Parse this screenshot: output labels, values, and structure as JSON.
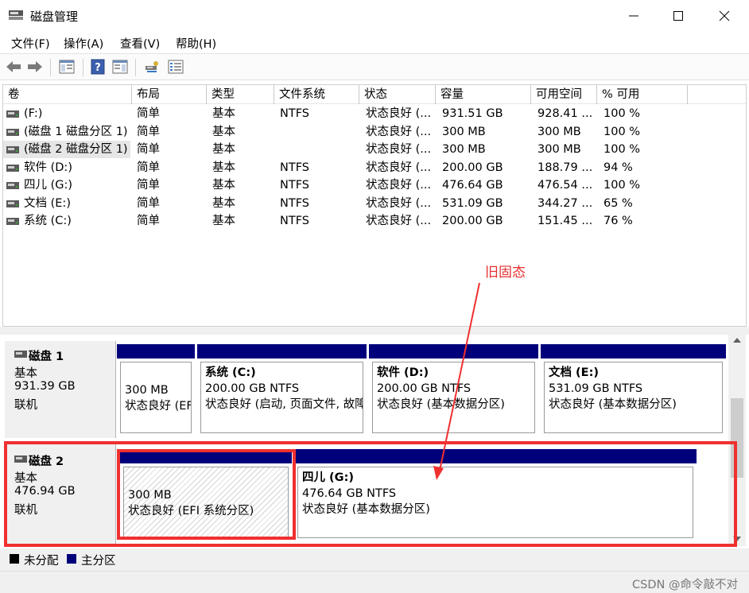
{
  "window": {
    "title": "磁盘管理"
  },
  "menu": [
    "文件(F)",
    "操作(A)",
    "查看(V)",
    "帮助(H)"
  ],
  "columns": [
    "卷",
    "布局",
    "类型",
    "文件系统",
    "状态",
    "容量",
    "可用空间",
    "% 可用"
  ],
  "volumes": [
    {
      "name": "(F:)",
      "layout": "简单",
      "type": "基本",
      "fs": "NTFS",
      "status": "状态良好 (...",
      "capacity": "931.51 GB",
      "free": "928.41 ...",
      "pct": "100 %"
    },
    {
      "name": "(磁盘 1 磁盘分区 1)",
      "layout": "简单",
      "type": "基本",
      "fs": "",
      "status": "状态良好 (...",
      "capacity": "300 MB",
      "free": "300 MB",
      "pct": "100 %"
    },
    {
      "name": "(磁盘 2 磁盘分区 1)",
      "layout": "简单",
      "type": "基本",
      "fs": "",
      "status": "状态良好 (...",
      "capacity": "300 MB",
      "free": "300 MB",
      "pct": "100 %"
    },
    {
      "name": "软件 (D:)",
      "layout": "简单",
      "type": "基本",
      "fs": "NTFS",
      "status": "状态良好 (...",
      "capacity": "200.00 GB",
      "free": "188.79 ...",
      "pct": "94 %"
    },
    {
      "name": "四儿 (G:)",
      "layout": "简单",
      "type": "基本",
      "fs": "NTFS",
      "status": "状态良好 (...",
      "capacity": "476.64 GB",
      "free": "476.54 ...",
      "pct": "100 %"
    },
    {
      "name": "文档 (E:)",
      "layout": "简单",
      "type": "基本",
      "fs": "NTFS",
      "status": "状态良好 (...",
      "capacity": "531.09 GB",
      "free": "344.27 ...",
      "pct": "65 %"
    },
    {
      "name": "系统 (C:)",
      "layout": "简单",
      "type": "基本",
      "fs": "NTFS",
      "status": "状态良好 (...",
      "capacity": "200.00 GB",
      "free": "151.45 ...",
      "pct": "76 %"
    }
  ],
  "disks": [
    {
      "name": "磁盘 1",
      "type": "基本",
      "size": "931.39 GB",
      "state": "联机",
      "partitions": [
        {
          "name": "",
          "size": "300 MB",
          "status": "状态良好 (EFI"
        },
        {
          "name": "系统 (C:)",
          "size": "200.00 GB NTFS",
          "status": "状态良好 (启动, 页面文件, 故障"
        },
        {
          "name": "软件 (D:)",
          "size": "200.00 GB NTFS",
          "status": "状态良好 (基本数据分区)"
        },
        {
          "name": "文档 (E:)",
          "size": "531.09 GB NTFS",
          "status": "状态良好 (基本数据分区)"
        }
      ]
    },
    {
      "name": "磁盘 2",
      "type": "基本",
      "size": "476.94 GB",
      "state": "联机",
      "partitions": [
        {
          "name": "",
          "size": "300 MB",
          "status": "状态良好 (EFI 系统分区)"
        },
        {
          "name": "四儿 (G:)",
          "size": "476.64 GB NTFS",
          "status": "状态良好 (基本数据分区)"
        }
      ]
    }
  ],
  "legend": [
    {
      "label": "未分配",
      "color": "#000000"
    },
    {
      "label": "主分区",
      "color": "#00007b"
    }
  ],
  "annotation": {
    "text": "旧固态",
    "color": "#e63030"
  },
  "watermark": "CSDN @命令敲不对"
}
